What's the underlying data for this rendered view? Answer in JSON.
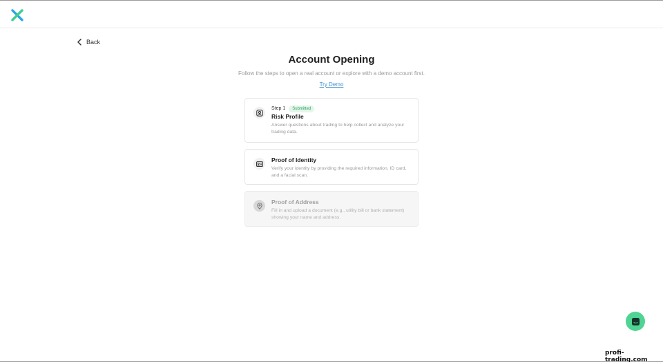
{
  "header": {
    "logo_icon": "x-logo-icon",
    "logo_colors": [
      "#2aa7e0",
      "#3ccf8e"
    ]
  },
  "nav": {
    "back_label": "Back"
  },
  "main": {
    "title": "Account Opening",
    "subtitle": "Follow the steps to open a real account or explore with a demo account first.",
    "try_demo_label": "Try Demo"
  },
  "steps": [
    {
      "step_label": "Step 1",
      "badge": "Submitted",
      "title": "Risk Profile",
      "description_line1": "Answer questions about trading to help collect and analyze your",
      "description_line2": "trading data.",
      "icon": "user-profile-icon",
      "state": "submitted"
    },
    {
      "title": "Proof of Identity",
      "description_line1": "Verify your identity by providing the required information, ID card,",
      "description_line2": "and a facial scan.",
      "icon": "id-card-icon",
      "state": "active"
    },
    {
      "title": "Proof of Address",
      "description_line1": "Fill in and upload a document (e.g., utility bill or bank statement)",
      "description_line2": "showing your name and address.",
      "icon": "location-pin-icon",
      "state": "disabled"
    }
  ],
  "chat_icon": "chat-icon",
  "watermark": "profi-trading.com",
  "colors": {
    "accent_link": "#3a8fd0",
    "badge_green": "#2f9e5e",
    "chat_green": "#4fd493"
  }
}
